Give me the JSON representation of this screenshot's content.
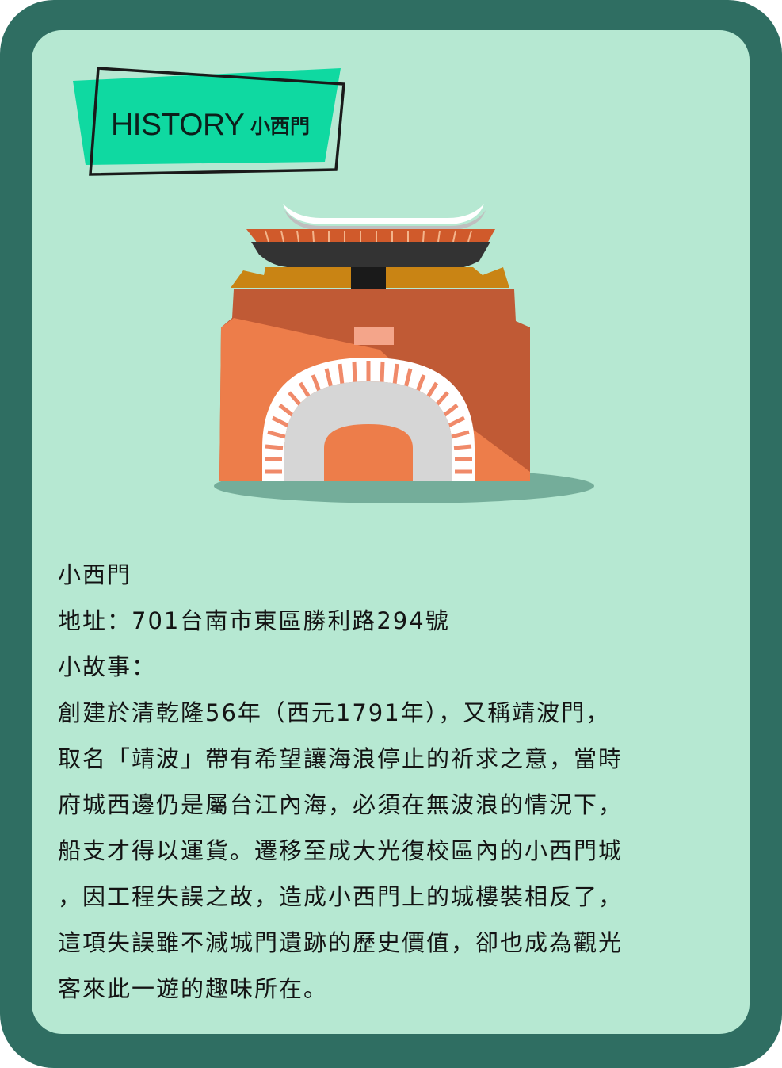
{
  "tag": {
    "word": "HISTORY",
    "name": "小西門"
  },
  "colors": {
    "frame": "#2f6e62",
    "panel": "#b6e8d2",
    "tag_fill": "#0fd9a1",
    "gate_front": "#ed7d4a",
    "gate_shade": "#c05a35",
    "roof_orange": "#c98414",
    "roof_dark": "#333333"
  },
  "info": {
    "title": "小西門",
    "address": "地址：701台南市東區勝利路294號",
    "story_label": "小故事：",
    "story_lines": [
      "創建於清乾隆56年（西元1791年），又稱靖波門，",
      "取名「靖波」帶有希望讓海浪停止的祈求之意，當時",
      "府城西邊仍是屬台江內海，必須在無波浪的情況下，",
      "船支才得以運貨。遷移至成大光復校區內的小西門城",
      "，因工程失誤之故，造成小西門上的城樓裝相反了，",
      "這項失誤雖不減城門遺跡的歷史價值，卻也成為觀光",
      "客來此一遊的趣味所在。"
    ]
  }
}
